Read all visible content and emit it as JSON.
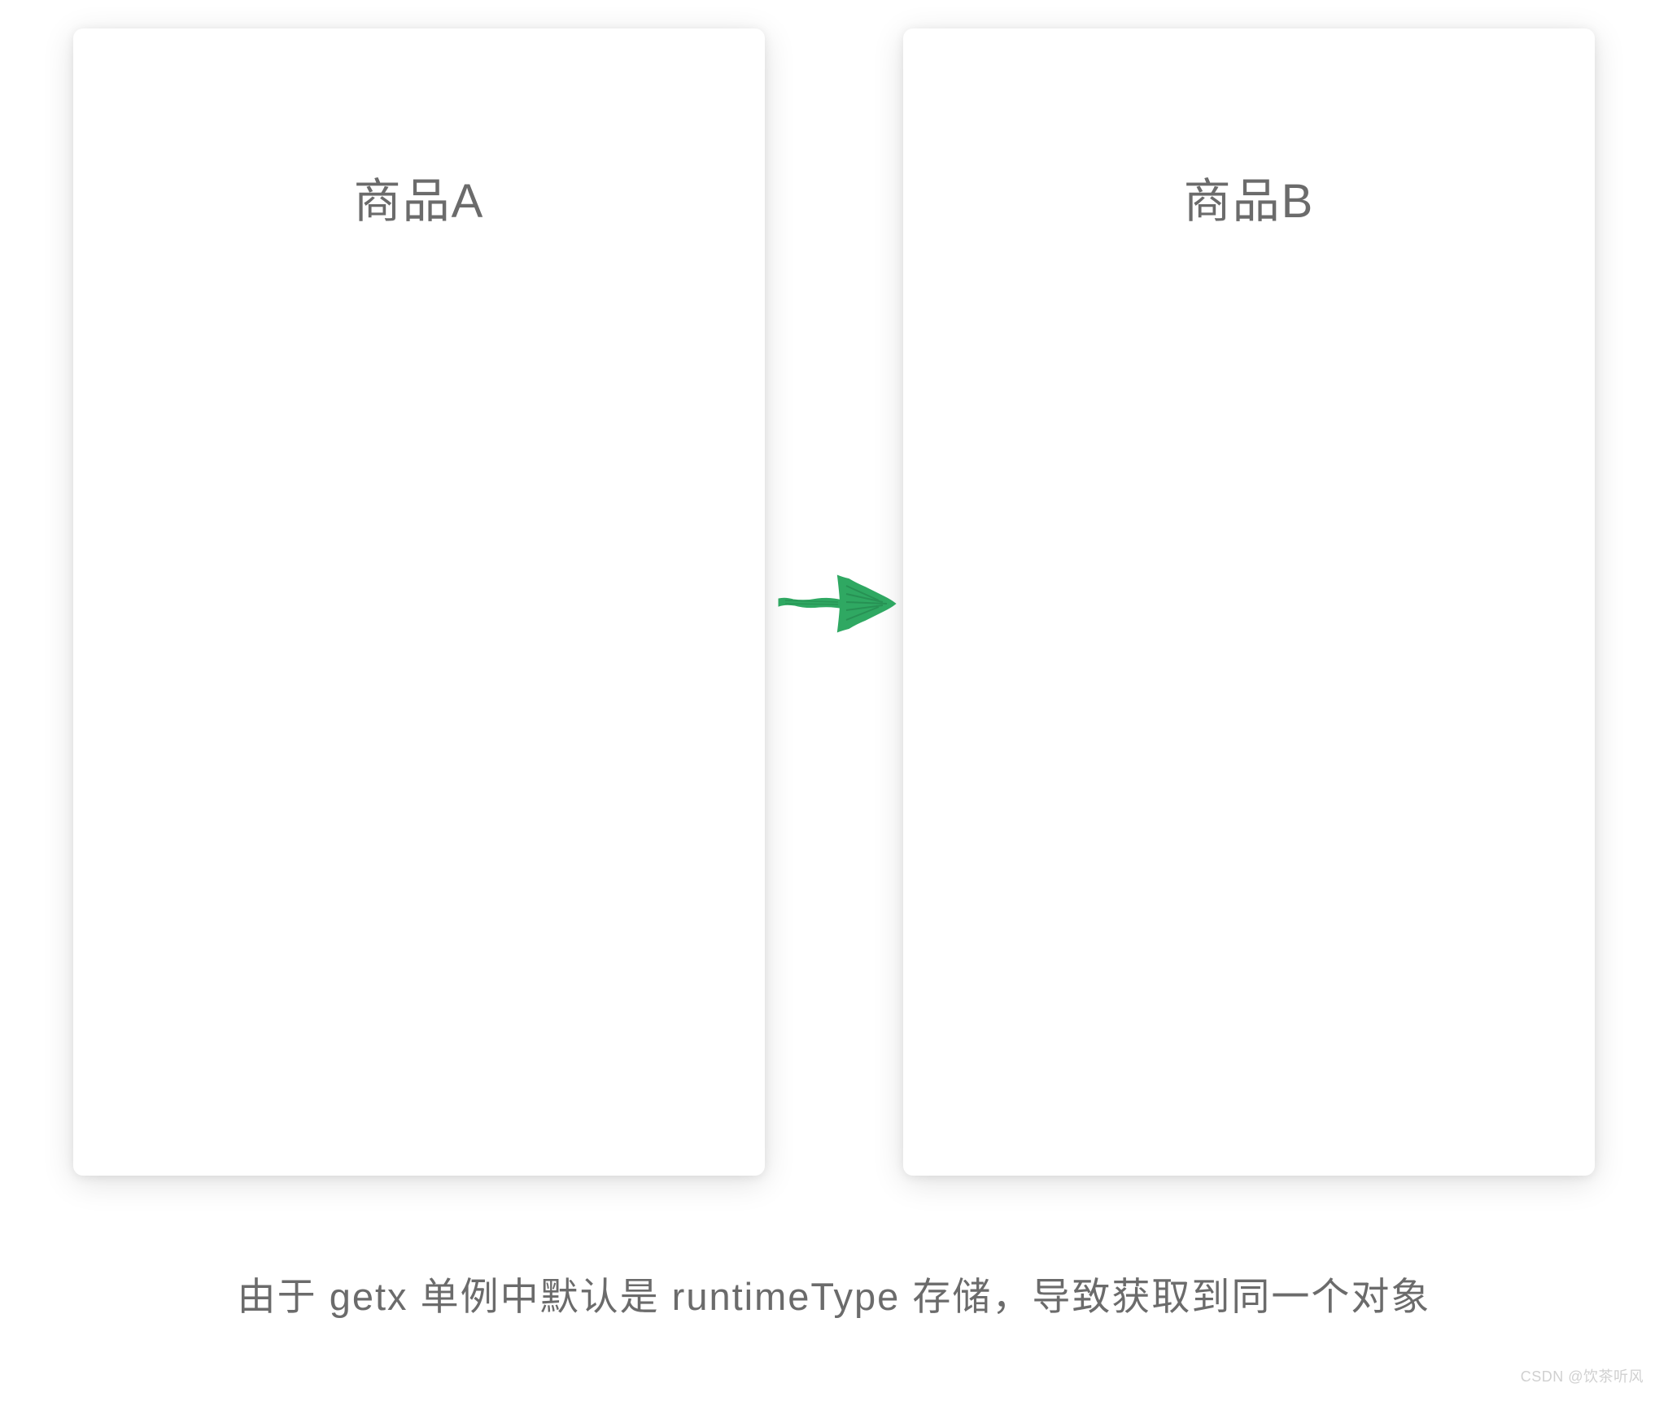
{
  "panels": {
    "left": {
      "title": "商品A"
    },
    "right": {
      "title": "商品B"
    }
  },
  "arrow": {
    "color": "#2fa862",
    "name": "arrow-right"
  },
  "caption": "由于 getx 单例中默认是 runtimeType 存储，导致获取到同一个对象",
  "watermark": "CSDN @饮茶听风"
}
